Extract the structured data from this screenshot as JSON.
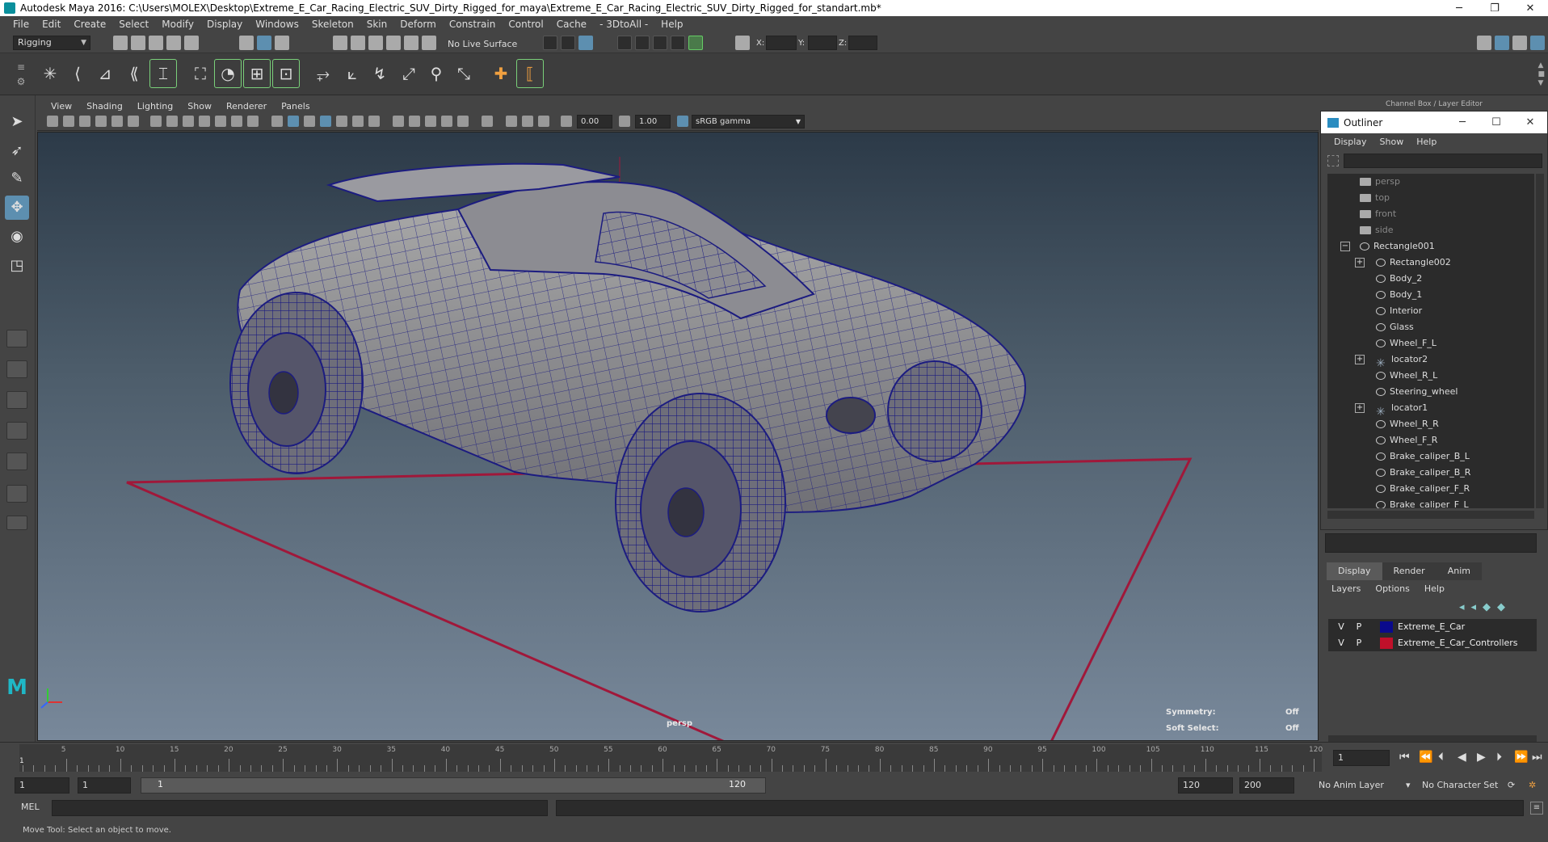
{
  "window": {
    "title": "Autodesk Maya 2016: C:\\Users\\MOLEX\\Desktop\\Extreme_E_Car_Racing_Electric_SUV_Dirty_Rigged_for_maya\\Extreme_E_Car_Racing_Electric_SUV_Dirty_Rigged_for_standart.mb*",
    "minimize": "─",
    "restore": "❐",
    "close": "✕"
  },
  "menubar": [
    "File",
    "Edit",
    "Create",
    "Select",
    "Modify",
    "Display",
    "Windows",
    "Skeleton",
    "Skin",
    "Deform",
    "Constrain",
    "Control",
    "Cache",
    "- 3DtoAll -",
    "Help"
  ],
  "statusline": {
    "mode": "Rigging",
    "live_surface": "No Live Surface",
    "x_label": "X:",
    "y_label": "Y:",
    "z_label": "Z:"
  },
  "viewport": {
    "menu": [
      "View",
      "Shading",
      "Lighting",
      "Show",
      "Renderer",
      "Panels"
    ],
    "exposure": "0.00",
    "gamma": "1.00",
    "color_space": "sRGB gamma",
    "camera_label": "persp",
    "hud_symmetry_label": "Symmetry:",
    "hud_symmetry_value": "Off",
    "hud_softselect_label": "Soft Select:",
    "hud_softselect_value": "Off"
  },
  "channelbox_header": "Channel Box / Layer Editor",
  "outliner": {
    "title": "Outliner",
    "menu": [
      "Display",
      "Show",
      "Help"
    ],
    "items": [
      {
        "label": "persp",
        "type": "camera"
      },
      {
        "label": "top",
        "type": "camera"
      },
      {
        "label": "front",
        "type": "camera"
      },
      {
        "label": "side",
        "type": "camera"
      },
      {
        "label": "Rectangle001",
        "type": "xform"
      },
      {
        "label": "Rectangle002",
        "type": "xform"
      },
      {
        "label": "Body_2",
        "type": "xform"
      },
      {
        "label": "Body_1",
        "type": "xform"
      },
      {
        "label": "Interior",
        "type": "xform"
      },
      {
        "label": "Glass",
        "type": "xform"
      },
      {
        "label": "Wheel_F_L",
        "type": "xform"
      },
      {
        "label": "locator2",
        "type": "locator"
      },
      {
        "label": "Wheel_R_L",
        "type": "xform"
      },
      {
        "label": "Steering_wheel",
        "type": "xform"
      },
      {
        "label": "locator1",
        "type": "locator"
      },
      {
        "label": "Wheel_R_R",
        "type": "xform"
      },
      {
        "label": "Wheel_F_R",
        "type": "xform"
      },
      {
        "label": "Brake_caliper_B_L",
        "type": "xform"
      },
      {
        "label": "Brake_caliper_B_R",
        "type": "xform"
      },
      {
        "label": "Brake_caliper_F_R",
        "type": "xform"
      },
      {
        "label": "Brake_caliper_F_L",
        "type": "xform"
      }
    ]
  },
  "layer_editor": {
    "tabs": [
      "Display",
      "Render",
      "Anim"
    ],
    "menu": [
      "Layers",
      "Options",
      "Help"
    ],
    "layers": [
      {
        "v": "V",
        "p": "P",
        "color": "#0a0a8c",
        "name": "Extreme_E_Car"
      },
      {
        "v": "V",
        "p": "P",
        "color": "#c0102a",
        "name": "Extreme_E_Car_Controllers"
      }
    ]
  },
  "timeline": {
    "ticks": [
      5,
      10,
      15,
      20,
      25,
      30,
      35,
      40,
      45,
      50,
      55,
      60,
      65,
      70,
      75,
      80,
      85,
      90,
      95,
      100,
      105,
      110,
      115,
      120
    ],
    "start_marker": "1",
    "current_frame": "1"
  },
  "range": {
    "start": "1",
    "playback_start": "1",
    "slider_start": "1",
    "slider_end": "120",
    "playback_end": "120",
    "end": "200",
    "anim_layer": "No Anim Layer",
    "character_set": "No Character Set"
  },
  "commandline": {
    "label": "MEL"
  },
  "helpline": "Move Tool: Select an object to move.",
  "colors": {
    "wire": "#1c1c80",
    "grid_boundary": "#a0183a",
    "accent": "#5d8fb0"
  }
}
